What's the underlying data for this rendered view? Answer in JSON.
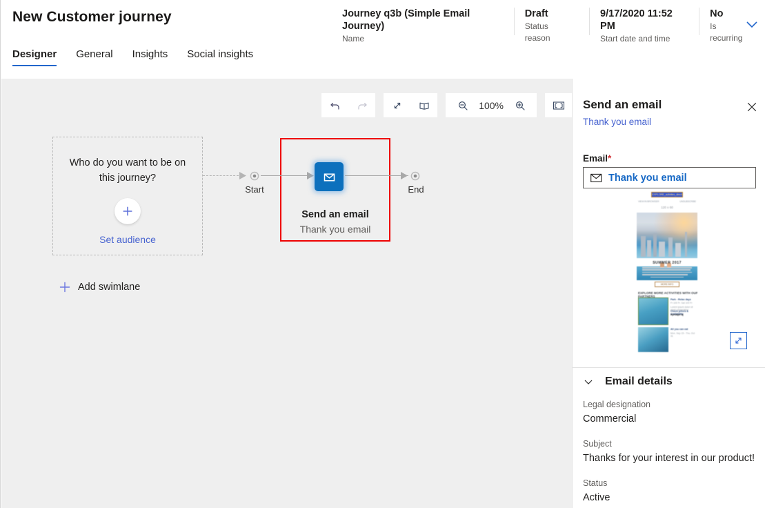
{
  "header": {
    "title": "New Customer journey",
    "meta": [
      {
        "value": "Journey q3b (Simple Email Journey)",
        "label": "Name"
      },
      {
        "value": "Draft",
        "label": "Status reason"
      },
      {
        "value": "9/17/2020 11:52 PM",
        "label": "Start date and time"
      },
      {
        "value": "No",
        "label": "Is recurring"
      }
    ],
    "chevron_icon": "chevron-down-icon"
  },
  "tabs": [
    {
      "label": "Designer",
      "active": true
    },
    {
      "label": "General",
      "active": false
    },
    {
      "label": "Insights",
      "active": false
    },
    {
      "label": "Social insights",
      "active": false
    }
  ],
  "toolbar": {
    "undo_icon": "undo-icon",
    "redo_icon": "redo-icon",
    "expand_icon": "expand-diagonal-icon",
    "map_icon": "mini-map-icon",
    "zoom_out_icon": "zoom-out-icon",
    "zoom_level": "100%",
    "zoom_in_icon": "zoom-in-icon",
    "fit_icon": "fit-to-screen-icon"
  },
  "canvas": {
    "swimlane": {
      "question": "Who do you want to be on this journey?",
      "plus_icon": "plus-icon",
      "link": "Set audience"
    },
    "add_swimlane": {
      "icon": "plus-icon",
      "label": "Add swimlane"
    },
    "start_label": "Start",
    "end_label": "End",
    "start_icon": "start-node-icon",
    "end_icon": "end-node-icon",
    "email_card": {
      "icon": "email-envelope-icon",
      "title": "Send an email",
      "subtitle": "Thank you email",
      "selection_color": "#ee0000",
      "tile_color": "#0d70bd"
    }
  },
  "panel": {
    "title": "Send an email",
    "subtitle": "Thank you email",
    "close_icon": "close-icon",
    "field_label": "Email",
    "required_marker": "*",
    "email_value": "Thank you email",
    "email_icon": "email-envelope-icon",
    "expand_icon": "expand-diagonal-icon",
    "preview": {
      "chip": "EXPLORE_activities_direct",
      "left_small": "VIEW IN BROWSER",
      "right_small": "UNSUBSCRIBE",
      "dimension": "120 x 60",
      "heading": "SUMMER 2017",
      "cta": "MORE INFO",
      "section_heading": "EXPLORE MORE ACTIVITIES WITH OUR PARTNERS",
      "item1_title": "Park - Relax days",
      "item1_line1": "Fr 100 Fr. Sat 100 Fr",
      "item1_line2": "Lorem ipsum dolor sit amet consectetur",
      "item1_link": "Check prices & availability",
      "item1_bold": "Aproape aj",
      "item2_title": "All you can eat",
      "item2_line1": "Mon. Sep 15 - Thu. Oct 31"
    },
    "details": {
      "chevron_icon": "chevron-down-icon",
      "title": "Email details",
      "rows": [
        {
          "label": "Legal designation",
          "value": "Commercial"
        },
        {
          "label": "Subject",
          "value": "Thanks for your interest in our product!"
        },
        {
          "label": "Status",
          "value": "Active"
        }
      ]
    }
  }
}
